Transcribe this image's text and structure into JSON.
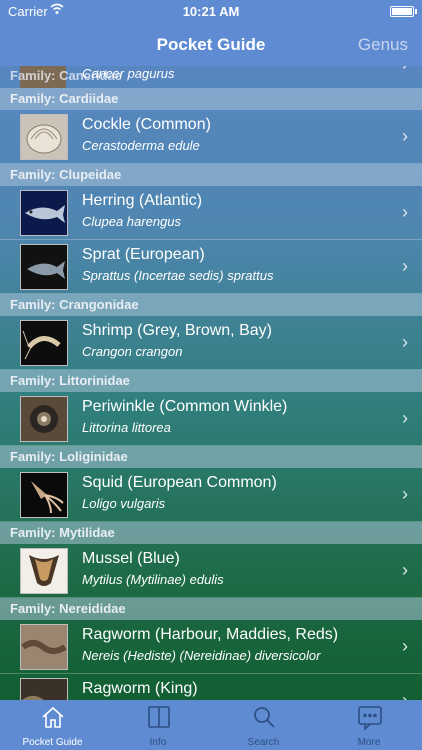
{
  "status": {
    "carrier": "Carrier",
    "time": "10:21 AM"
  },
  "nav": {
    "title": "Pocket Guide",
    "genus": "Genus"
  },
  "partial": {
    "family_label": "Family: Cancridae",
    "sci": "Cancer pagurus"
  },
  "sections": [
    {
      "family": "Family: Cardiidae",
      "items": [
        {
          "name": "Cockle (Common)",
          "sci": "Cerastoderma edule",
          "thumb": "cockle"
        }
      ]
    },
    {
      "family": "Family: Clupeidae",
      "items": [
        {
          "name": "Herring (Atlantic)",
          "sci": "Clupea harengus",
          "thumb": "herring"
        },
        {
          "name": "Sprat (European)",
          "sci": "Sprattus (Incertae sedis) sprattus",
          "thumb": "sprat"
        }
      ]
    },
    {
      "family": "Family: Crangonidae",
      "items": [
        {
          "name": "Shrimp (Grey, Brown, Bay)",
          "sci": "Crangon crangon",
          "thumb": "shrimp"
        }
      ]
    },
    {
      "family": "Family: Littorinidae",
      "items": [
        {
          "name": "Periwinkle (Common Winkle)",
          "sci": "Littorina littorea",
          "thumb": "periwinkle"
        }
      ]
    },
    {
      "family": "Family: Loliginidae",
      "items": [
        {
          "name": "Squid (European Common)",
          "sci": "Loligo vulgaris",
          "thumb": "squid"
        }
      ]
    },
    {
      "family": "Family: Mytilidae",
      "items": [
        {
          "name": "Mussel (Blue)",
          "sci": "Mytilus (Mytilinae) edulis",
          "thumb": "mussel"
        }
      ]
    },
    {
      "family": "Family: Nereididae",
      "items": [
        {
          "name": "Ragworm (Harbour, Maddies, Reds)",
          "sci": "Nereis (Hediste) (Nereidinae) diversicolor",
          "thumb": "ragworm"
        },
        {
          "name": "Ragworm (King)",
          "sci": "",
          "thumb": "ragworm-king"
        }
      ]
    }
  ],
  "tabs": [
    {
      "label": "Pocket Guide",
      "icon": "home-icon",
      "active": true
    },
    {
      "label": "Info",
      "icon": "book-icon",
      "active": false
    },
    {
      "label": "Search",
      "icon": "search-icon",
      "active": false
    },
    {
      "label": "More",
      "icon": "more-icon",
      "active": false
    }
  ]
}
